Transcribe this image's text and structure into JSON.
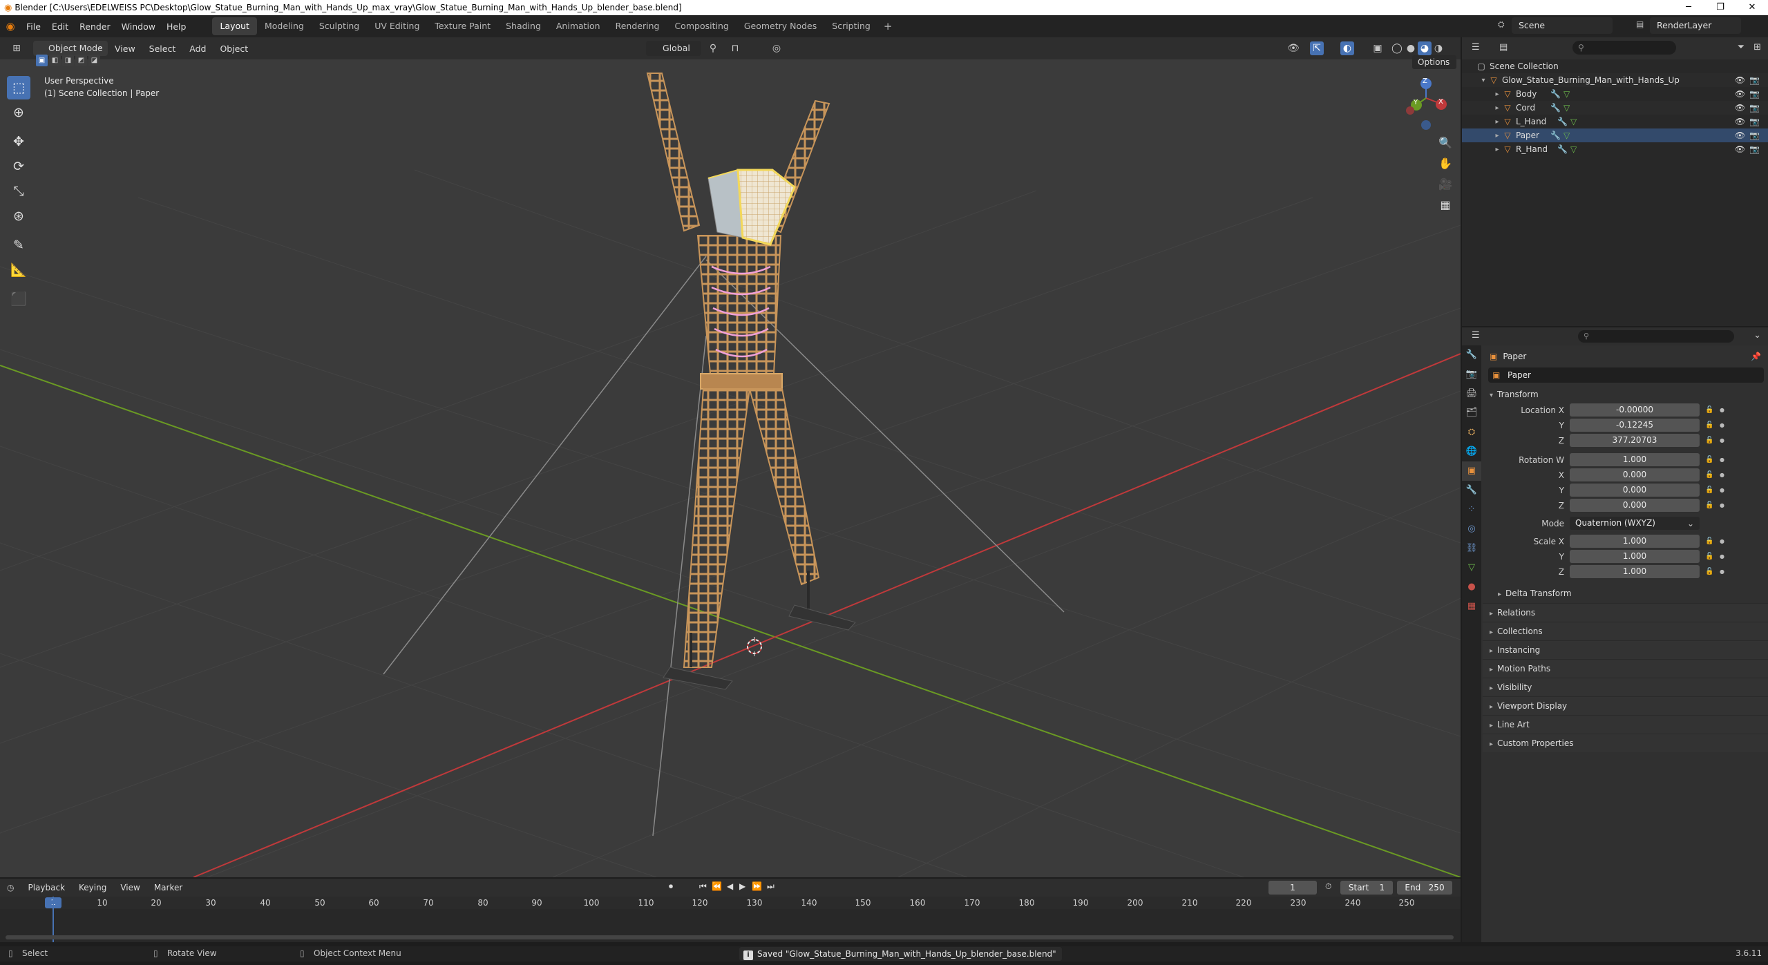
{
  "window": {
    "title": "Blender [C:\\Users\\EDELWEISS PC\\Desktop\\Glow_Statue_Burning_Man_with_Hands_Up_max_vray\\Glow_Statue_Burning_Man_with_Hands_Up_blender_base.blend]",
    "minimize": "─",
    "maximize": "❐",
    "close": "✕"
  },
  "menubar": {
    "items": [
      "File",
      "Edit",
      "Render",
      "Window",
      "Help"
    ],
    "workspaces": [
      "Layout",
      "Modeling",
      "Sculpting",
      "UV Editing",
      "Texture Paint",
      "Shading",
      "Animation",
      "Rendering",
      "Compositing",
      "Geometry Nodes",
      "Scripting"
    ],
    "active_workspace": "Layout",
    "add_label": "+",
    "scene": "Scene",
    "render_layer": "RenderLayer"
  },
  "viewport_header": {
    "mode": "Object Mode",
    "menus": [
      "View",
      "Select",
      "Add",
      "Object"
    ],
    "orientation": "Global",
    "options": "Options"
  },
  "viewport": {
    "perspective": "User Perspective",
    "collection_info": "(1) Scene Collection | Paper",
    "gizmo": {
      "x": "X",
      "y": "Y",
      "z": "Z"
    }
  },
  "toolbar": {
    "tools": [
      "select-box-icon",
      "cursor-icon",
      "move-icon",
      "rotate-icon",
      "scale-icon",
      "transform-icon",
      "annotate-icon",
      "measure-icon",
      "add-cube-icon"
    ]
  },
  "outliner": {
    "search_placeholder": "",
    "root": "Scene Collection",
    "collection": "Glow_Statue_Burning_Man_with_Hands_Up",
    "objects": [
      "Body",
      "Cord",
      "L_Hand",
      "Paper",
      "R_Hand"
    ]
  },
  "properties": {
    "object_title": "Paper",
    "object_name": "Paper",
    "transform_label": "Transform",
    "location_x_label": "Location X",
    "location_x": "-0.00000",
    "location_y_label": "Y",
    "location_y": "-0.12245",
    "location_z_label": "Z",
    "location_z": "377.20703",
    "rotation_w_label": "Rotation W",
    "rotation_w": "1.000",
    "rotation_x_label": "X",
    "rotation_x": "0.000",
    "rotation_y_label": "Y",
    "rotation_y": "0.000",
    "rotation_z_label": "Z",
    "rotation_z": "0.000",
    "mode_label": "Mode",
    "mode_value": "Quaternion (WXYZ)",
    "scale_x_label": "Scale X",
    "scale_x": "1.000",
    "scale_y_label": "Y",
    "scale_y": "1.000",
    "scale_z_label": "Z",
    "scale_z": "1.000",
    "delta_transform": "Delta Transform",
    "panels": [
      "Relations",
      "Collections",
      "Instancing",
      "Motion Paths",
      "Visibility",
      "Viewport Display",
      "Line Art",
      "Custom Properties"
    ]
  },
  "timeline": {
    "menus": [
      "Playback",
      "Keying",
      "View",
      "Marker"
    ],
    "current_frame": "1",
    "start_label": "Start",
    "start": "1",
    "end_label": "End",
    "end": "250",
    "ruler": [
      "10",
      "20",
      "30",
      "40",
      "50",
      "60",
      "70",
      "80",
      "90",
      "100",
      "110",
      "120",
      "130",
      "140",
      "150",
      "160",
      "170",
      "180",
      "190",
      "200",
      "210",
      "220",
      "230",
      "240",
      "250"
    ],
    "cursor_frame": "1"
  },
  "statusbar": {
    "select": "Select",
    "rotate_view": "Rotate View",
    "context_menu": "Object Context Menu",
    "saved_message": "Saved \"Glow_Statue_Burning_Man_with_Hands_Up_blender_base.blend\"",
    "version": "3.6.11"
  },
  "colors": {
    "accent": "#4772b3",
    "x_axis": "#c0393b",
    "y_axis": "#6a9a23",
    "wood": "#c8955a",
    "glow": "#f0a0d8"
  }
}
